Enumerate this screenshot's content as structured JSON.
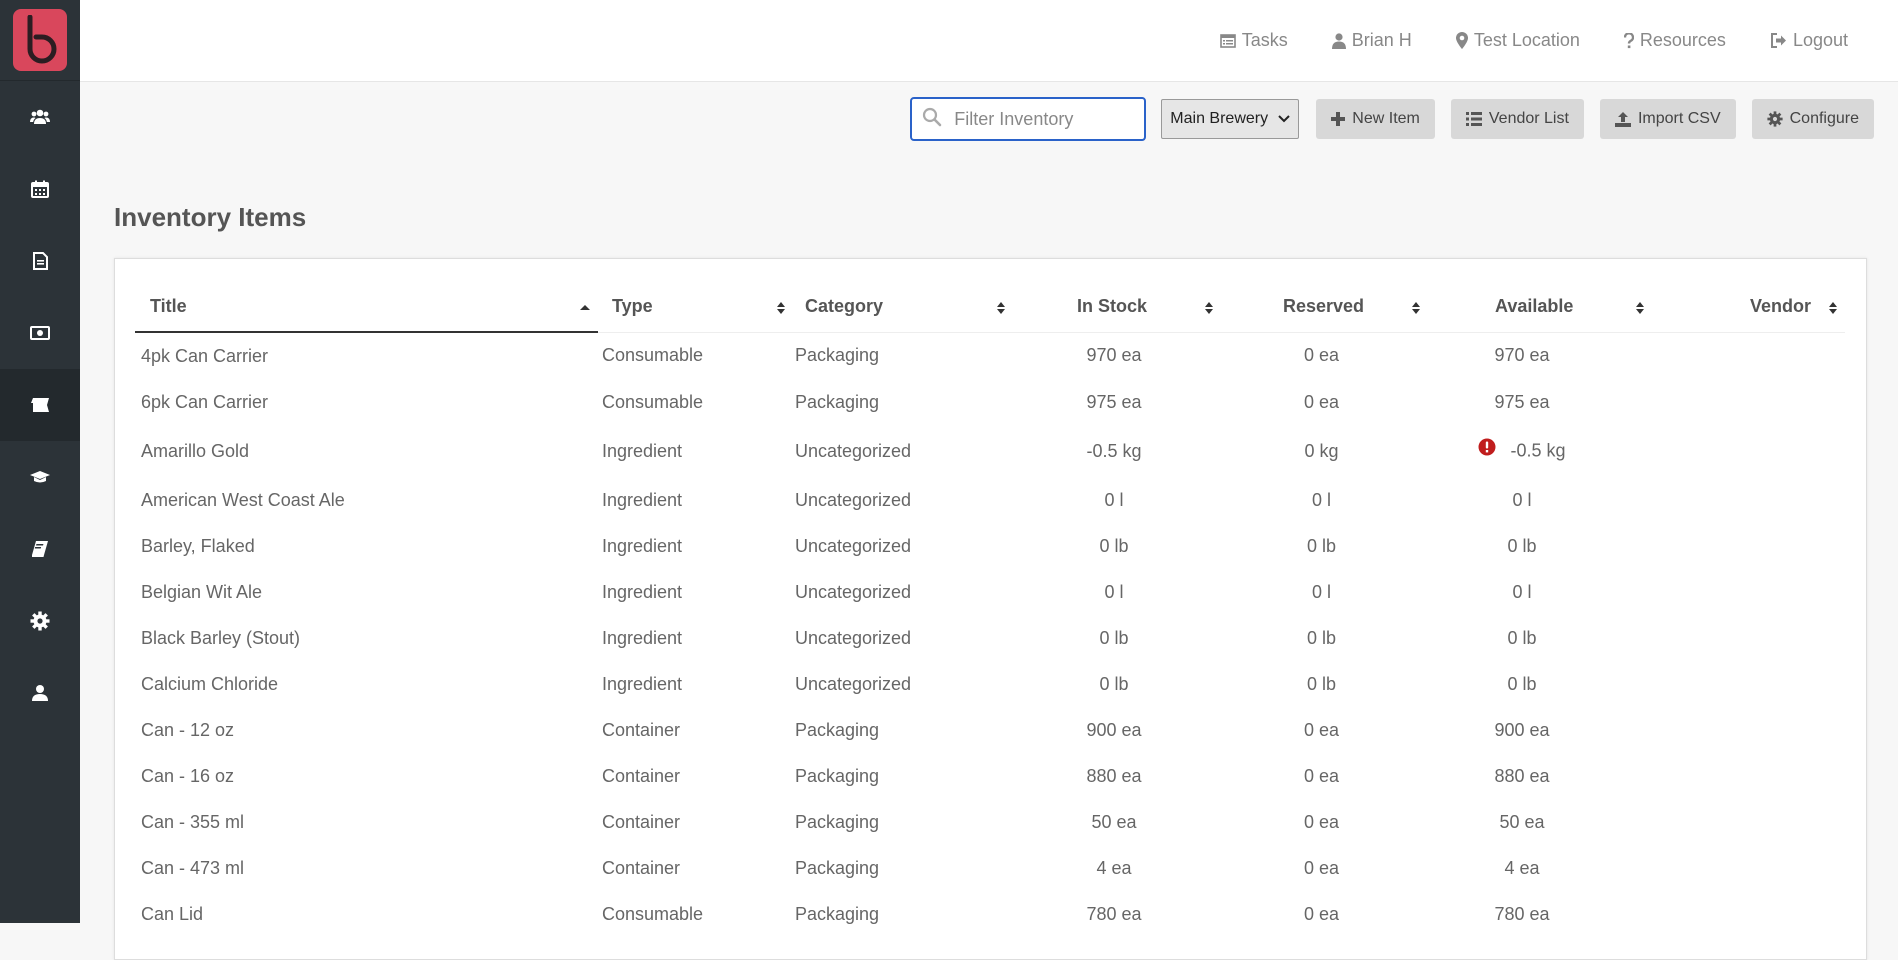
{
  "topnav": {
    "tasks": "Tasks",
    "user": "Brian H",
    "location": "Test Location",
    "resources": "Resources",
    "logout": "Logout"
  },
  "toolbar": {
    "search_placeholder": "Filter Inventory",
    "location_select": "Main Brewery",
    "new_item": "New Item",
    "vendor_list": "Vendor List",
    "import_csv": "Import CSV",
    "configure": "Configure"
  },
  "sidebar": {
    "icons": [
      "users-icon",
      "calendar-icon",
      "document-icon",
      "money-icon",
      "ticket-icon",
      "graduation-cap-icon",
      "book-icon",
      "gear-icon",
      "user-icon"
    ],
    "active_index": 4
  },
  "page": {
    "title": "Inventory Items"
  },
  "table": {
    "columns": [
      "Title",
      "Type",
      "Category",
      "In Stock",
      "Reserved",
      "Available",
      "Vendor"
    ],
    "rows": [
      {
        "title": "4pk Can Carrier",
        "type": "Consumable",
        "category": "Packaging",
        "in_stock": "970 ea",
        "reserved": "0 ea",
        "available": "970 ea",
        "vendor": ""
      },
      {
        "title": "6pk Can Carrier",
        "type": "Consumable",
        "category": "Packaging",
        "in_stock": "975 ea",
        "reserved": "0 ea",
        "available": "975 ea",
        "vendor": ""
      },
      {
        "title": "Amarillo Gold",
        "type": "Ingredient",
        "category": "Uncategorized",
        "in_stock": "-0.5 kg",
        "reserved": "0 kg",
        "available": "-0.5 kg",
        "vendor": "",
        "warning": true
      },
      {
        "title": "American West Coast Ale",
        "type": "Ingredient",
        "category": "Uncategorized",
        "in_stock": "0 l",
        "reserved": "0 l",
        "available": "0 l",
        "vendor": ""
      },
      {
        "title": "Barley, Flaked",
        "type": "Ingredient",
        "category": "Uncategorized",
        "in_stock": "0 lb",
        "reserved": "0 lb",
        "available": "0 lb",
        "vendor": ""
      },
      {
        "title": "Belgian Wit Ale",
        "type": "Ingredient",
        "category": "Uncategorized",
        "in_stock": "0 l",
        "reserved": "0 l",
        "available": "0 l",
        "vendor": ""
      },
      {
        "title": "Black Barley (Stout)",
        "type": "Ingredient",
        "category": "Uncategorized",
        "in_stock": "0 lb",
        "reserved": "0 lb",
        "available": "0 lb",
        "vendor": ""
      },
      {
        "title": "Calcium Chloride",
        "type": "Ingredient",
        "category": "Uncategorized",
        "in_stock": "0 lb",
        "reserved": "0 lb",
        "available": "0 lb",
        "vendor": ""
      },
      {
        "title": "Can - 12 oz",
        "type": "Container",
        "category": "Packaging",
        "in_stock": "900 ea",
        "reserved": "0 ea",
        "available": "900 ea",
        "vendor": ""
      },
      {
        "title": "Can - 16 oz",
        "type": "Container",
        "category": "Packaging",
        "in_stock": "880 ea",
        "reserved": "0 ea",
        "available": "880 ea",
        "vendor": ""
      },
      {
        "title": "Can - 355 ml",
        "type": "Container",
        "category": "Packaging",
        "in_stock": "50 ea",
        "reserved": "0 ea",
        "available": "50 ea",
        "vendor": ""
      },
      {
        "title": "Can - 473 ml",
        "type": "Container",
        "category": "Packaging",
        "in_stock": "4 ea",
        "reserved": "0 ea",
        "available": "4 ea",
        "vendor": ""
      },
      {
        "title": "Can Lid",
        "type": "Consumable",
        "category": "Packaging",
        "in_stock": "780 ea",
        "reserved": "0 ea",
        "available": "780 ea",
        "vendor": ""
      }
    ]
  },
  "colors": {
    "sidebar_bg": "#2c3338",
    "brand": "#d9475c",
    "focus_border": "#2a62c9",
    "warning": "#c01d1d"
  }
}
